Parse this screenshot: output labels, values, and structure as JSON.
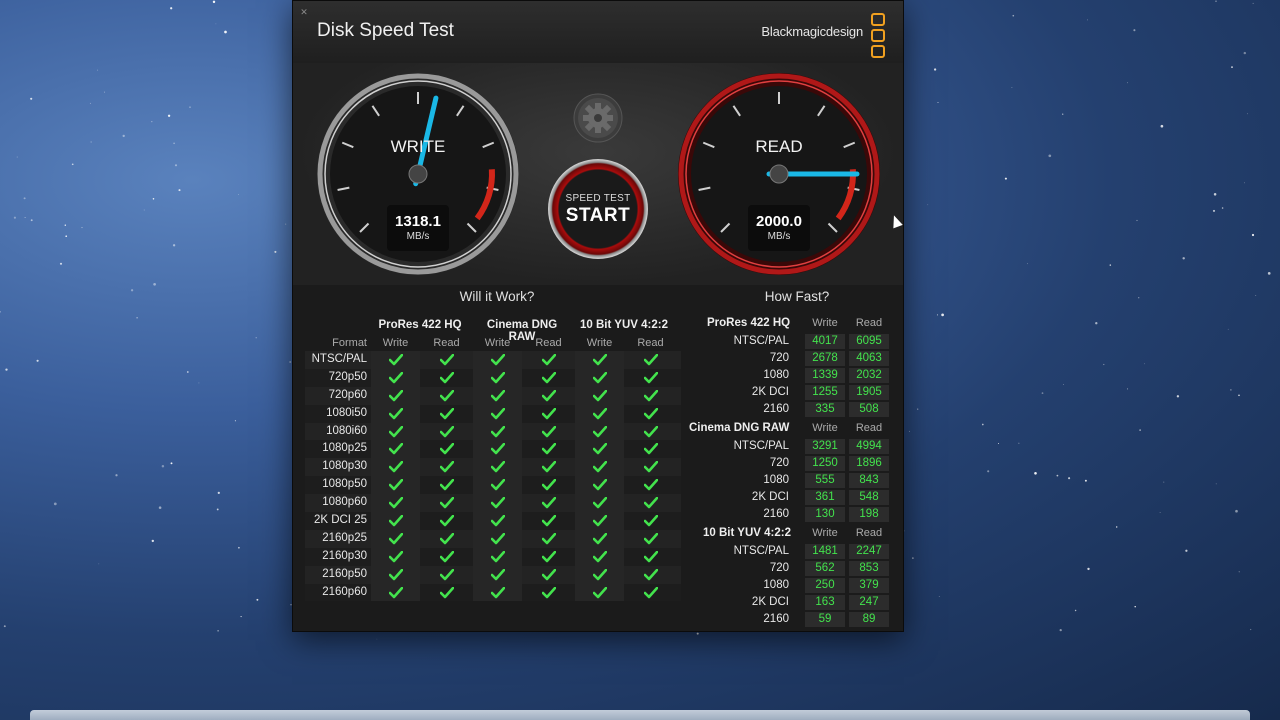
{
  "app": {
    "title": "Disk Speed Test",
    "brand": "Blackmagicdesign",
    "close_icon": "close-icon"
  },
  "colors": {
    "accent_green": "#43e34d",
    "needle": "#1ab8e6",
    "logo_orange": "#f0a020",
    "start_red": "#aa0c0c"
  },
  "gauges": {
    "write": {
      "label": "WRITE",
      "value": "1318.1",
      "unit": "MB/s",
      "level": 1318.1
    },
    "read": {
      "label": "READ",
      "value": "2000.0",
      "unit": "MB/s",
      "level": 2000.0
    }
  },
  "start_button": {
    "small": "SPEED TEST",
    "big": "START"
  },
  "settings_icon": "gear-icon",
  "will_it_work": {
    "title": "Will it Work?",
    "format_header": "Format",
    "groups": [
      {
        "name": "ProRes 422 HQ",
        "cols": [
          "Write",
          "Read"
        ]
      },
      {
        "name": "Cinema DNG RAW",
        "cols": [
          "Write",
          "Read"
        ]
      },
      {
        "name": "10 Bit YUV 4:2:2",
        "cols": [
          "Write",
          "Read"
        ]
      }
    ],
    "formats": [
      "NTSC/PAL",
      "720p50",
      "720p60",
      "1080i50",
      "1080i60",
      "1080p25",
      "1080p30",
      "1080p50",
      "1080p60",
      "2K DCI 25",
      "2160p25",
      "2160p30",
      "2160p50",
      "2160p60"
    ],
    "check_icon": "checkmark-icon"
  },
  "how_fast": {
    "title": "How Fast?",
    "groups": [
      {
        "name": "ProRes 422 HQ",
        "write_label": "Write",
        "read_label": "Read",
        "rows": [
          {
            "label": "NTSC/PAL",
            "write": "4017",
            "read": "6095"
          },
          {
            "label": "720",
            "write": "2678",
            "read": "4063"
          },
          {
            "label": "1080",
            "write": "1339",
            "read": "2032"
          },
          {
            "label": "2K DCI",
            "write": "1255",
            "read": "1905"
          },
          {
            "label": "2160",
            "write": "335",
            "read": "508"
          }
        ]
      },
      {
        "name": "Cinema DNG RAW",
        "write_label": "Write",
        "read_label": "Read",
        "rows": [
          {
            "label": "NTSC/PAL",
            "write": "3291",
            "read": "4994"
          },
          {
            "label": "720",
            "write": "1250",
            "read": "1896"
          },
          {
            "label": "1080",
            "write": "555",
            "read": "843"
          },
          {
            "label": "2K DCI",
            "write": "361",
            "read": "548"
          },
          {
            "label": "2160",
            "write": "130",
            "read": "198"
          }
        ]
      },
      {
        "name": "10 Bit YUV 4:2:2",
        "write_label": "Write",
        "read_label": "Read",
        "rows": [
          {
            "label": "NTSC/PAL",
            "write": "1481",
            "read": "2247"
          },
          {
            "label": "720",
            "write": "562",
            "read": "853"
          },
          {
            "label": "1080",
            "write": "250",
            "read": "379"
          },
          {
            "label": "2K DCI",
            "write": "163",
            "read": "247"
          },
          {
            "label": "2160",
            "write": "59",
            "read": "89"
          }
        ]
      }
    ]
  }
}
